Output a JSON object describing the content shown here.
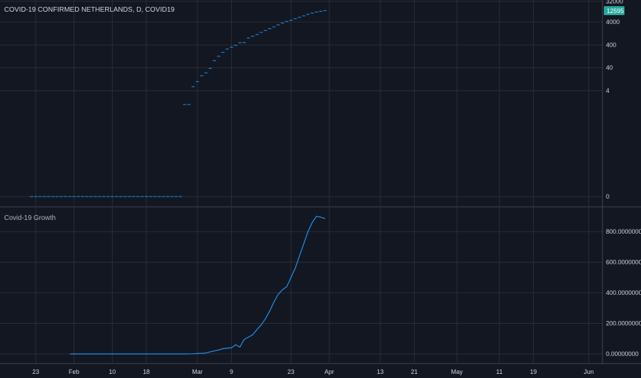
{
  "chart_title": "COVID-19 CONFIRMED NETHERLANDS, D, COVID19",
  "lower_pane_title": "Covid-19 Growth",
  "last_value_badge": "12595",
  "colors": {
    "background": "#131722",
    "grid": "#2a2e39",
    "text": "#d1d4dc",
    "series": "#2196f3",
    "badge": "#26a69a",
    "separator": "#434651"
  },
  "chart_data": [
    {
      "type": "line",
      "title": "COVID-19 CONFIRMED NETHERLANDS, D, COVID19",
      "y_scale": "log",
      "y_ticks": [
        "32000",
        "4000",
        "400",
        "40",
        "4",
        "0"
      ],
      "x_ticks": [
        "23",
        "Feb",
        "10",
        "18",
        "Mar",
        "9",
        "23",
        "Apr",
        "13",
        "21",
        "May",
        "11",
        "19",
        "Jun"
      ],
      "last_value": 12595,
      "series": [
        {
          "x": [
            "2020-01-22",
            "2020-01-23",
            "2020-01-24",
            "2020-01-25",
            "2020-01-26",
            "2020-01-27",
            "2020-01-28",
            "2020-01-29",
            "2020-01-30",
            "2020-01-31",
            "2020-02-01",
            "2020-02-02",
            "2020-02-03",
            "2020-02-04",
            "2020-02-05",
            "2020-02-06",
            "2020-02-07",
            "2020-02-08",
            "2020-02-09",
            "2020-02-10",
            "2020-02-11",
            "2020-02-12",
            "2020-02-13",
            "2020-02-14",
            "2020-02-15",
            "2020-02-16",
            "2020-02-17",
            "2020-02-18",
            "2020-02-19",
            "2020-02-20",
            "2020-02-21",
            "2020-02-22",
            "2020-02-23",
            "2020-02-24",
            "2020-02-25",
            "2020-02-26",
            "2020-02-27",
            "2020-02-28",
            "2020-02-29",
            "2020-03-01",
            "2020-03-02",
            "2020-03-03",
            "2020-03-04",
            "2020-03-05",
            "2020-03-06",
            "2020-03-07",
            "2020-03-08",
            "2020-03-09",
            "2020-03-10",
            "2020-03-11",
            "2020-03-12",
            "2020-03-13",
            "2020-03-14",
            "2020-03-15",
            "2020-03-16",
            "2020-03-17",
            "2020-03-18",
            "2020-03-19",
            "2020-03-20",
            "2020-03-21",
            "2020-03-22",
            "2020-03-23",
            "2020-03-24",
            "2020-03-25",
            "2020-03-26",
            "2020-03-27",
            "2020-03-28",
            "2020-03-29",
            "2020-03-30",
            "2020-03-31"
          ],
          "values": [
            0,
            0,
            0,
            0,
            0,
            0,
            0,
            0,
            0,
            0,
            0,
            0,
            0,
            0,
            0,
            0,
            0,
            0,
            0,
            0,
            0,
            0,
            0,
            0,
            0,
            0,
            0,
            0,
            0,
            0,
            0,
            0,
            0,
            0,
            0,
            0,
            1,
            1,
            6,
            10,
            18,
            24,
            38,
            82,
            128,
            188,
            265,
            321,
            382,
            503,
            503,
            804,
            959,
            1135,
            1413,
            1705,
            2051,
            2460,
            2994,
            3631,
            4204,
            4749,
            5560,
            6412,
            7431,
            8603,
            9762,
            10866,
            11750,
            12595
          ]
        }
      ]
    },
    {
      "type": "line",
      "title": "Covid-19 Growth",
      "ylim": [
        0,
        900
      ],
      "y_ticks": [
        "800.00000000",
        "600.00000000",
        "400.00000000",
        "200.00000000",
        "0.00000000"
      ],
      "series": [
        {
          "x": [
            "2020-01-31",
            "2020-02-05",
            "2020-02-10",
            "2020-02-15",
            "2020-02-20",
            "2020-02-25",
            "2020-02-27",
            "2020-02-29",
            "2020-03-01",
            "2020-03-02",
            "2020-03-03",
            "2020-03-04",
            "2020-03-05",
            "2020-03-06",
            "2020-03-07",
            "2020-03-08",
            "2020-03-09",
            "2020-03-10",
            "2020-03-11",
            "2020-03-12",
            "2020-03-13",
            "2020-03-14",
            "2020-03-15",
            "2020-03-16",
            "2020-03-17",
            "2020-03-18",
            "2020-03-19",
            "2020-03-20",
            "2020-03-21",
            "2020-03-22",
            "2020-03-23",
            "2020-03-24",
            "2020-03-25",
            "2020-03-26",
            "2020-03-27",
            "2020-03-28",
            "2020-03-29",
            "2020-03-30",
            "2020-03-31"
          ],
          "values": [
            0,
            0,
            0,
            0,
            0,
            0,
            0,
            1,
            3,
            4,
            6,
            14,
            20,
            26,
            34,
            38,
            40,
            60,
            45,
            95,
            110,
            125,
            160,
            190,
            230,
            280,
            340,
            390,
            420,
            440,
            500,
            560,
            640,
            720,
            800,
            860,
            900,
            895,
            885
          ]
        }
      ]
    }
  ]
}
